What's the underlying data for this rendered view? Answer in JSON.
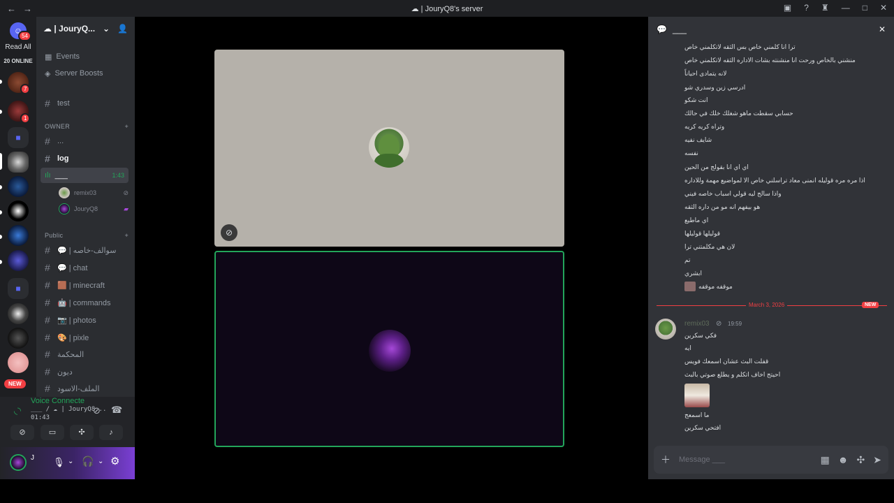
{
  "titlebar": {
    "back": "←",
    "forward": "→",
    "title": "☁ | JouryQ8's server"
  },
  "rail": {
    "top_badge": "54",
    "read_all": "Read All",
    "online": "20 ONLINE",
    "badge_1": "7",
    "badge_2": "1",
    "new_label": "NEW"
  },
  "server": {
    "name": "☁ | JouryQ...",
    "events": "Events",
    "boosts": "Server Boosts",
    "test": "test"
  },
  "categories": {
    "owner": "OWNER",
    "public": "Public"
  },
  "channels": {
    "dots": "...",
    "log": "log",
    "voice": "___",
    "voice_time": "1:43",
    "vuser1": "remix03",
    "vuser2": "JouryQ8",
    "public": [
      "💬 | سوالف-خاصه",
      "💬 | chat",
      "🟫 | minecraft",
      "🤖 | commands",
      "📷 | photos",
      "🎨 | pixle",
      "المحكمة",
      "ديون",
      "الملف-الاسود"
    ]
  },
  "voice_panel": {
    "title": "Voice Connecte",
    "sub": "___ / ☁ | JouryQ8...",
    "time": "01:43"
  },
  "user_panel": {
    "name": "J"
  },
  "chat": {
    "title": "___",
    "messages": [
      "ترا انا كلمني خاص بس الثقه لاتكلمني خاص",
      "منشني بالخاص ورحت انا منشنته بشات الاداره الثقه لاتكلمني خاص",
      "لانه يتمادى احياناً",
      "ادرسي زين وسدري شو",
      "انت شكو",
      "حسابي سقطت ماهو شغلك خلك في حالك",
      "وتراه كريه كريه",
      "شايف نفيه",
      "نفسه",
      "اي اي انا بقولج من الحين",
      "اذا مره مره قوليله انمنى معاد تراسلني خاص الا لمواضيع مهمة وللاداره",
      "واذا سالج ليه قولي اسباب خاصه فيني",
      "هو بيفهم انه مو من داره الثقه",
      "اي ماطيع",
      "قوليلها قوليلها",
      "لان هي مكلمتني ترا",
      "تم",
      "ابشري",
      "موقفه موقفه"
    ],
    "divider_date": "March 3, 2026",
    "divider_new": "NEW",
    "author": "remix03",
    "author_time": "19:59",
    "new_messages": [
      "فكي سكرين",
      "ايه",
      "قفلت البث عشان اسمعك فويس",
      "احيتج اخاف اتكلم و يطلع صوتي بالبث",
      "ما اسمعج",
      "افتحي سكرين"
    ],
    "composer_placeholder": "Message ___"
  }
}
